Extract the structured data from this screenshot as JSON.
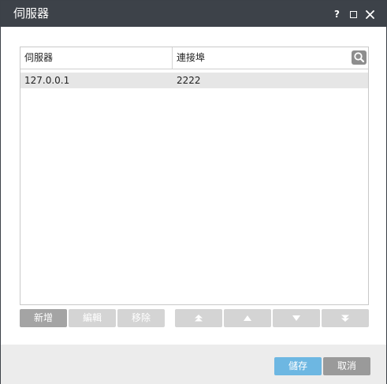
{
  "window": {
    "title": "伺服器"
  },
  "table": {
    "columns": {
      "server": "伺服器",
      "port": "連接埠"
    },
    "rows": [
      {
        "server": "127.0.0.1",
        "port": "2222"
      }
    ]
  },
  "buttons": {
    "add": "新增",
    "edit": "編輯",
    "remove": "移除"
  },
  "footer": {
    "save": "儲存",
    "cancel": "取消"
  },
  "icons": {
    "help": "help-icon",
    "maximize": "maximize-icon",
    "close": "close-icon",
    "search": "search-icon",
    "move_top": "double-chevron-up-icon",
    "move_up": "triangle-up-icon",
    "move_down": "triangle-down-icon",
    "move_bottom": "double-chevron-down-icon"
  },
  "colors": {
    "titlebar": "#3d4249",
    "selected_row": "#e6e6e6",
    "primary_button": "#6db7e2",
    "secondary_button": "#9a9a9a",
    "active_button": "#a4a4a4",
    "disabled_button": "#d4d4d4"
  }
}
